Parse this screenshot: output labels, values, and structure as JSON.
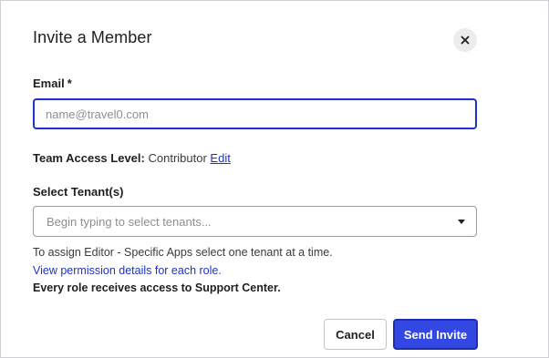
{
  "dialog": {
    "title": "Invite a Member",
    "close_icon": "close-icon"
  },
  "email": {
    "label": "Email",
    "required_mark": "*",
    "placeholder": "name@travel0.com",
    "value": ""
  },
  "access": {
    "label": "Team Access Level:",
    "value": "Contributor",
    "edit_link": "Edit"
  },
  "tenants": {
    "label": "Select Tenant(s)",
    "placeholder": "Begin typing to select tenants...",
    "caret_icon": "caret-down-icon"
  },
  "help": {
    "line1": "To assign Editor - Specific Apps select one tenant at a time.",
    "link": "View permission details for each role.",
    "line2": "Every role receives access to Support Center."
  },
  "actions": {
    "cancel_label": "Cancel",
    "send_label": "Send Invite"
  },
  "colors": {
    "accent": "#3348e3",
    "link": "#1d33c7",
    "focus_border": "#1d33c7"
  }
}
